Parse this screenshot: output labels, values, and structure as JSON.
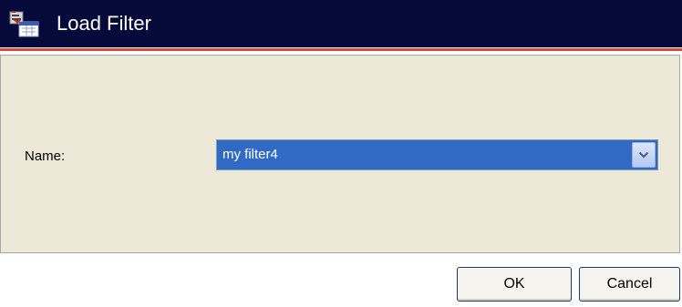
{
  "window": {
    "title": "Load Filter",
    "title_icon": "load-filter-icon"
  },
  "form": {
    "name_label": "Name:",
    "name_selected": "my filter4",
    "dropdown_icon": "chevron-down-icon"
  },
  "buttons": {
    "ok_label": "OK",
    "cancel_label": "Cancel"
  },
  "colors": {
    "titlebar": "#050a3a",
    "accent": "#d84b3a",
    "content_bg": "#ece9d8",
    "selection": "#316ac5"
  }
}
